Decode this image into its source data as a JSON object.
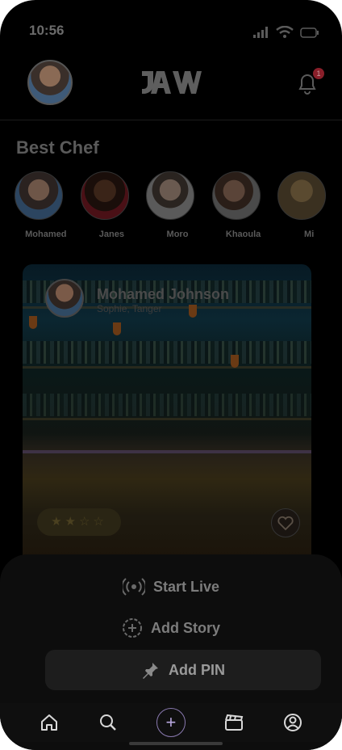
{
  "status": {
    "time": "10:56"
  },
  "header": {
    "brand": "JAVW",
    "notifications_count": "1"
  },
  "section_title": "Best Chef",
  "chefs": [
    {
      "name": "Mohamed"
    },
    {
      "name": "Janes"
    },
    {
      "name": "Moro"
    },
    {
      "name": "Khaoula"
    },
    {
      "name": "Mi"
    }
  ],
  "post": {
    "author": "Mohamed Johnson",
    "location": "Sophie, Tanger",
    "rating": 2,
    "rating_max": 5,
    "rating_display": "★★☆☆"
  },
  "actions": {
    "live": "Start Live",
    "story": "Add Story",
    "pin": "Add PIN"
  },
  "icons": [
    "home-icon",
    "search-icon",
    "add-icon",
    "clapperboard-icon",
    "profile-icon",
    "bell-icon",
    "signal-icon",
    "wifi-icon",
    "battery-icon",
    "live-icon",
    "add-story-icon",
    "pin-icon",
    "heart-icon"
  ],
  "colors": {
    "accent": "#8a7ab0",
    "badge": "#8a1f2a"
  }
}
